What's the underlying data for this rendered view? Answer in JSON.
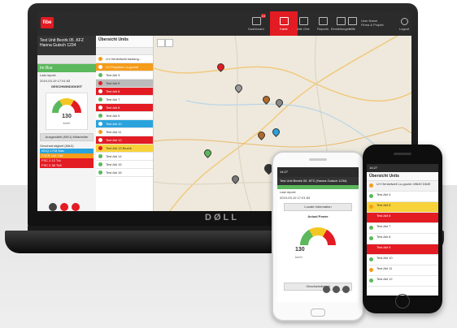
{
  "brand": {
    "logo_text": "fibe",
    "accent": "#e31b23",
    "dark": "#2b2b2b"
  },
  "header": {
    "nav": [
      {
        "label": "Dashboard",
        "icon": "dashboard-icon",
        "badge": "10"
      },
      {
        "label": "Karte",
        "icon": "map-icon",
        "active": true
      },
      {
        "label": "Alle Orte",
        "icon": "places-icon"
      },
      {
        "label": "Reports",
        "icon": "reports-icon"
      },
      {
        "label": "Einstellungen",
        "icon": "settings-icon"
      },
      {
        "label": "Hilfe",
        "icon": "help-icon"
      }
    ],
    "user_line1": "User Name",
    "user_line2": "Firma & Projekt",
    "logout": "Logout"
  },
  "left_panel": {
    "vehicle_line1": "Test Unit Bezirk 05 .KFZ",
    "vehicle_line2": "Hanna Gutsch 1234",
    "status": "Im Bus",
    "last_report_label": "Last report:",
    "last_report_value": "2019-03-19 17:01:53",
    "gauge_title": "GESCHWINDIGKEIT",
    "gauge_value": "130",
    "gauge_unit": "km/h",
    "button1": "Ausgewählt (NEU) Mitarbeiter",
    "info_line": "Geschwindigkeit (MAX)",
    "color_rows": [
      {
        "label": "WLQ 1.FM Max",
        "color": "#2aa3dd"
      },
      {
        "label": "FZCR 105 Tdd",
        "color": "#f59c1a"
      },
      {
        "label": "FSC 2.12 Tut",
        "color": "#e31b23"
      },
      {
        "label": "FSC 2.38 Tk8",
        "color": "#e31b23"
      }
    ]
  },
  "list_panel": {
    "title": "Übersicht Units",
    "items": [
      {
        "label": "LH Henkelweil tracking...",
        "style": "",
        "dot": "#f59c1a"
      },
      {
        "label": "LH Purpleon Lo-ppoint",
        "style": "li-orange",
        "dot": "#fff"
      },
      {
        "label": "Test Akt 3",
        "style": "",
        "dot": "#5bb85c"
      },
      {
        "label": "Test Akt 5",
        "style": "li-gray",
        "dot": "#e31b23"
      },
      {
        "label": "Test Akt 6",
        "style": "li-red",
        "dot": "#fff"
      },
      {
        "label": "Test Akt 7",
        "style": "",
        "dot": "#5bb85c"
      },
      {
        "label": "Test Akt 8",
        "style": "li-red",
        "dot": "#fff"
      },
      {
        "label": "Test Akt 9",
        "style": "",
        "dot": "#5bb85c"
      },
      {
        "label": "Test Akt 10",
        "style": "li-blue",
        "dot": "#fff"
      },
      {
        "label": "Test Akt 11",
        "style": "",
        "dot": "#f59c1a"
      },
      {
        "label": "Test Akt 12",
        "style": "li-red",
        "dot": "#fff"
      },
      {
        "label": "Test Akt 13 Bezirk",
        "style": "li-yellow",
        "dot": "#e31b23"
      },
      {
        "label": "Test Akt 14",
        "style": "",
        "dot": "#5bb85c"
      },
      {
        "label": "Test Akt 15",
        "style": "",
        "dot": "#5bb85c"
      },
      {
        "label": "Test Akt 16",
        "style": "",
        "dot": "#5bb85c"
      }
    ]
  },
  "laptop_brand": "DØLL",
  "phone_white": {
    "status_bar": "14:27",
    "title": "Test Unit Bezirk 05 .KFZ (Hanna Gutsch 1234)",
    "last_report_label": "Last report:",
    "last_report_value": "2019-03-19 17:01:53",
    "locate_btn": "Locate Information",
    "gauge_title": "Actual Power",
    "gauge_value": "130",
    "gauge_unit": "km/h",
    "bottom_btn": "Geschwindigkeit"
  },
  "phone_black": {
    "status_bar": "14:27",
    "title": "Übersicht Units",
    "items": [
      {
        "label": "LH Henkelweil Lo-ppoint 49649 D649",
        "dot": "#f59c1a",
        "bg": "#f2f2f2"
      },
      {
        "label": "Test Akt 4",
        "dot": "#5bb85c",
        "bg": "#fff"
      },
      {
        "label": "Test Akt 5",
        "dot": "#f59c1a",
        "bg": "#f7d23b"
      },
      {
        "label": "Test Akt 6",
        "dot": "#e31b23",
        "bg": "#e31b23"
      },
      {
        "label": "Test Akt 7",
        "dot": "#5bb85c",
        "bg": "#fff"
      },
      {
        "label": "Test Akt 8",
        "dot": "#5bb85c",
        "bg": "#fff"
      },
      {
        "label": "Test Akt 9",
        "dot": "#e31b23",
        "bg": "#e31b23"
      },
      {
        "label": "Test Akt 10",
        "dot": "#5bb85c",
        "bg": "#fff"
      },
      {
        "label": "Test Akt 11",
        "dot": "#f59c1a",
        "bg": "#fff"
      },
      {
        "label": "Test Akt 12",
        "dot": "#5bb85c",
        "bg": "#fff"
      }
    ]
  }
}
